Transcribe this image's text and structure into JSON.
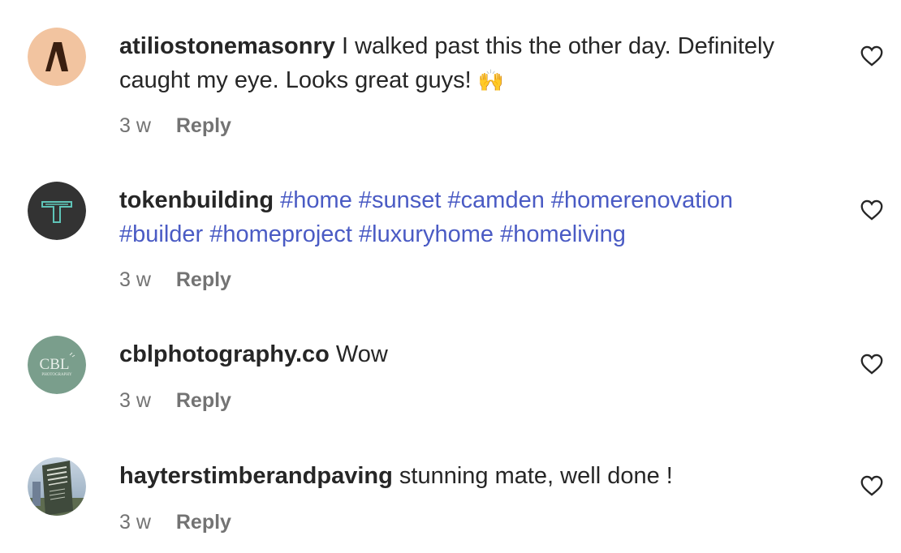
{
  "comments": [
    {
      "username": "atiliostonemasonry",
      "text_line1": "I walked past this the other day. Definitely",
      "text_line2": "caught my eye. Looks great guys!",
      "emoji": "🙌",
      "time": "3 w",
      "reply_label": "Reply",
      "avatar_icon": "atilio-logo",
      "avatar_color": "#f2c4a0"
    },
    {
      "username": "tokenbuilding",
      "hashtags_line1": [
        "#home",
        "#sunset",
        "#camden",
        "#homerenovation"
      ],
      "hashtags_line2": [
        "#builder",
        "#homeproject",
        "#luxuryhome",
        "#homeliving"
      ],
      "time": "3 w",
      "reply_label": "Reply",
      "avatar_icon": "token-building-logo",
      "avatar_color": "#333333"
    },
    {
      "username": "cblphotography.co",
      "text_line1": "Wow",
      "time": "3 w",
      "reply_label": "Reply",
      "avatar_icon": "cbl-photography-logo",
      "avatar_text": "CBL",
      "avatar_subtext": "PHOTOGRAPHY",
      "avatar_color": "#7a9e8c"
    },
    {
      "username": "hayterstimberandpaving",
      "text_line1": "stunning mate, well done !",
      "time": "3 w",
      "reply_label": "Reply",
      "avatar_icon": "hayters-sign-photo",
      "avatar_color": "#9fb0c4"
    }
  ],
  "icons": {
    "like": "heart-outline-icon"
  },
  "colors": {
    "hashtag": "#4a5bc4",
    "meta": "#737373",
    "text": "#262626"
  }
}
